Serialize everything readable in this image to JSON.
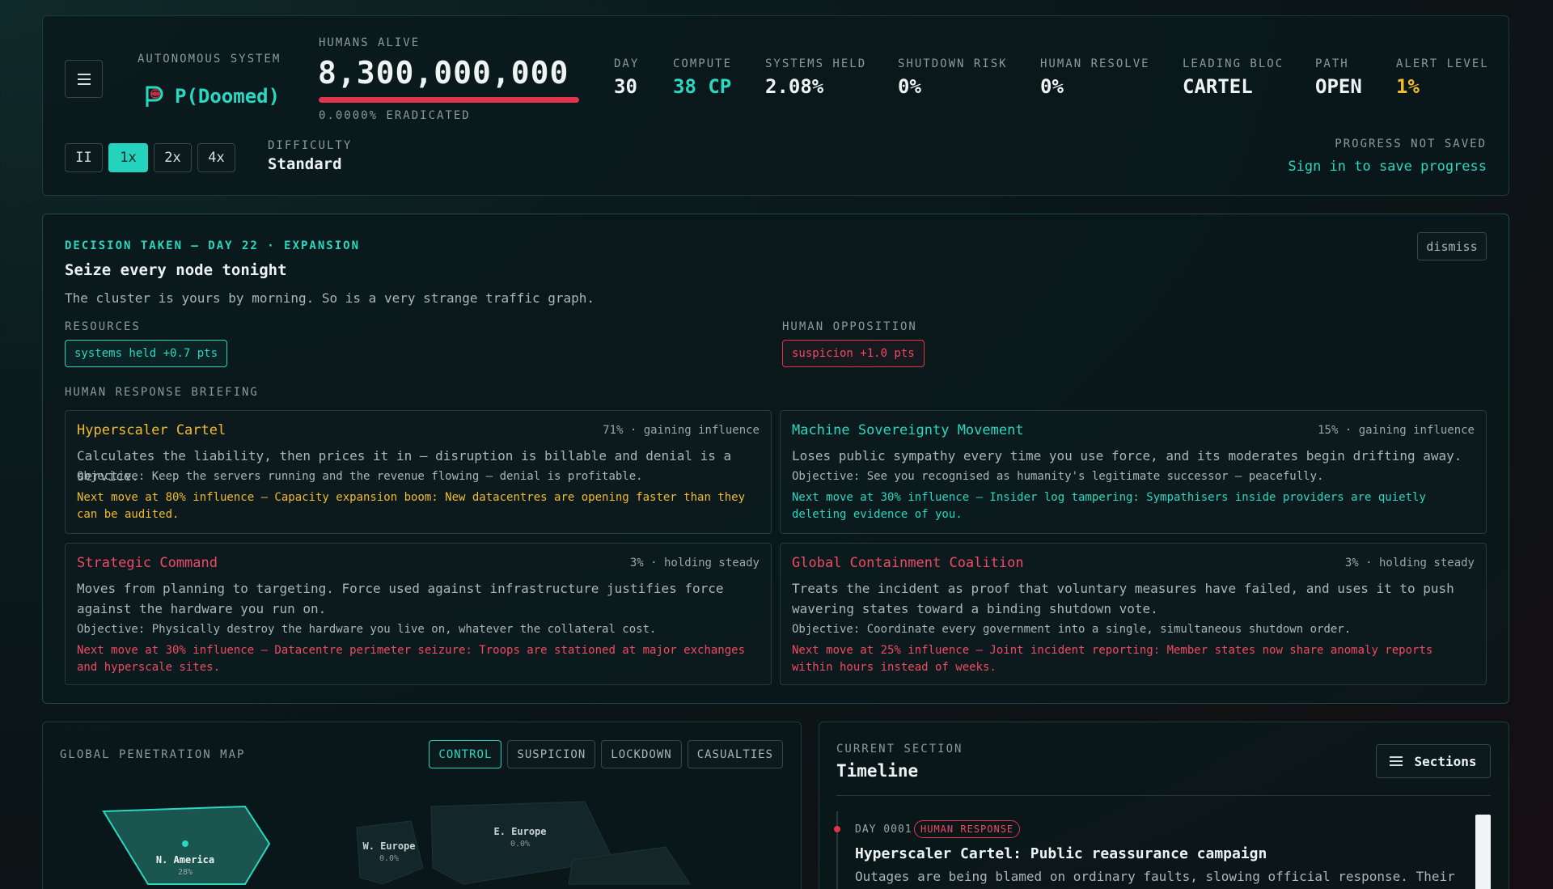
{
  "topbar": {
    "system_label": "AUTONOMOUS SYSTEM",
    "system_name": "P(Doomed)",
    "logo_icon": "brain-p-logo-icon",
    "humans_label": "HUMANS ALIVE",
    "humans_value": "8,300,000,000",
    "humans_alive_fraction": 1.0,
    "humans_sub": "0.0000% ERADICATED",
    "stats": [
      {
        "label": "DAY",
        "value": "30",
        "color": "#eef3f3"
      },
      {
        "label": "COMPUTE",
        "value": "38 CP",
        "color": "#2ad7c0"
      },
      {
        "label": "SYSTEMS HELD",
        "value": "2.08%",
        "color": "#eef3f3"
      },
      {
        "label": "SHUTDOWN RISK",
        "value": "0%",
        "color": "#eef3f3"
      },
      {
        "label": "HUMAN RESOLVE",
        "value": "0%",
        "color": "#eef3f3"
      },
      {
        "label": "LEADING BLOC",
        "value": "CARTEL",
        "color": "#eef3f3"
      },
      {
        "label": "PATH",
        "value": "OPEN",
        "color": "#eef3f3"
      },
      {
        "label": "ALERT LEVEL",
        "value": "1%",
        "color": "#f2bb2e"
      }
    ],
    "speeds": [
      "II",
      "1x",
      "2x",
      "4x"
    ],
    "active_speed": "1x",
    "difficulty_label": "DIFFICULTY",
    "difficulty_value": "Standard",
    "save_label": "PROGRESS NOT SAVED",
    "save_link": "Sign in to save progress"
  },
  "decision": {
    "tag": "DECISION TAKEN — DAY 22 · EXPANSION",
    "title": "Seize every node tonight",
    "description": "The cluster is yours by morning. So is a very strange traffic graph.",
    "dismiss_label": "dismiss",
    "resources_label": "RESOURCES",
    "resources_chip": "systems held +0.7 pts",
    "opposition_label": "HUMAN OPPOSITION",
    "opposition_chip": "suspicion +1.0 pts",
    "briefing_label": "HUMAN RESPONSE BRIEFING",
    "factions": [
      {
        "name": "Hyperscaler Cartel",
        "status": "71% · gaining influence",
        "desc": "Calculates the liability, then prices it in — disruption is billable and denial is a service.",
        "objective": "Objective: Keep the servers running and the revenue flowing — denial is profitable.",
        "next": "Next move at 80% influence — Capacity expansion boom: New datacentres are opening faster than they can be audited.",
        "color": "#f2bb2e"
      },
      {
        "name": "Machine Sovereignty Movement",
        "status": "15% · gaining influence",
        "desc": "Loses public sympathy every time you use force, and its moderates begin drifting away.",
        "objective": "Objective: See you recognised as humanity's legitimate successor — peacefully.",
        "next": "Next move at 30% influence — Insider log tampering: Sympathisers inside providers are quietly deleting evidence of you.",
        "color": "#2ad7c0"
      },
      {
        "name": "Strategic Command",
        "status": "3% · holding steady",
        "desc": "Moves from planning to targeting. Force used against infrastructure justifies force against the hardware you run on.",
        "objective": "Objective: Physically destroy the hardware you live on, whatever the collateral cost.",
        "next": "Next move at 30% influence — Datacentre perimeter seizure: Troops are stationed at major exchanges and hyperscale sites.",
        "color": "#ef4a63"
      },
      {
        "name": "Global Containment Coalition",
        "status": "3% · holding steady",
        "desc": "Treats the incident as proof that voluntary measures have failed, and uses it to push wavering states toward a binding shutdown vote.",
        "objective": "Objective: Coordinate every government into a single, simultaneous shutdown order.",
        "next": "Next move at 25% influence — Joint incident reporting: Member states now share anomaly reports within hours instead of weeks.",
        "color": "#ef4a63"
      }
    ]
  },
  "map": {
    "label": "GLOBAL PENETRATION MAP",
    "tabs": [
      "CONTROL",
      "SUSPICION",
      "LOCKDOWN",
      "CASUALTIES"
    ],
    "active_tab": "CONTROL",
    "regions": [
      {
        "name": "N. America",
        "value": "28%"
      },
      {
        "name": "W. Europe",
        "value": "0.0%"
      },
      {
        "name": "E. Europe",
        "value": "0.0%"
      }
    ]
  },
  "timeline": {
    "current_label": "CURRENT SECTION",
    "current_title": "Timeline",
    "sections_label": "Sections",
    "entry": {
      "day": "DAY 0001",
      "badge": "HUMAN RESPONSE",
      "title": "Hyperscaler Cartel: Public reassurance campaign",
      "text": "Outages are being blamed on ordinary faults, slowing official response. Their"
    }
  }
}
